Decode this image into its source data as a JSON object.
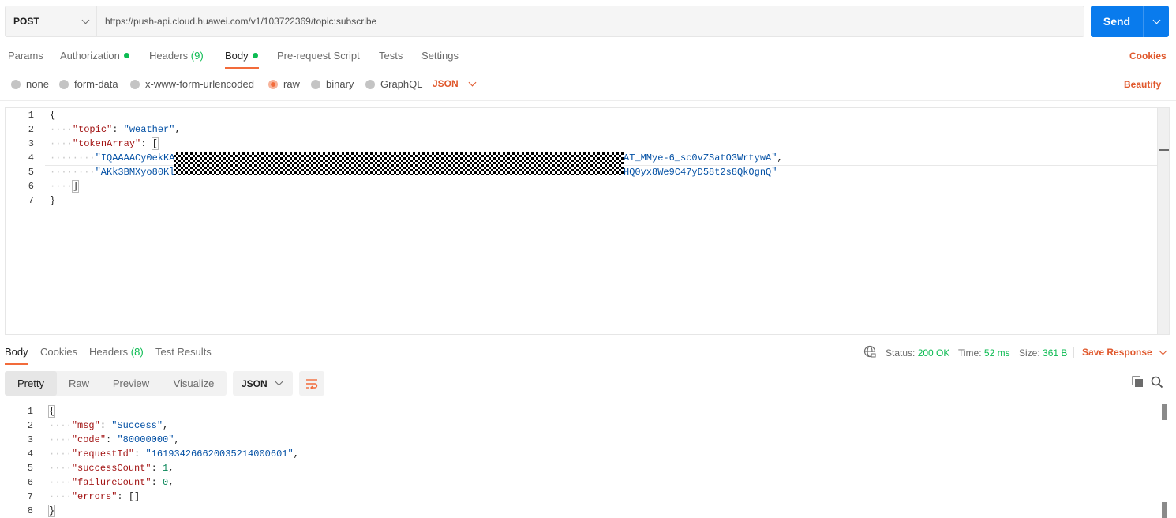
{
  "request": {
    "method": "POST",
    "url": "https://push-api.cloud.huawei.com/v1/103722369/topic:subscribe",
    "send_label": "Send"
  },
  "request_tabs": {
    "params": "Params",
    "authorization": "Authorization",
    "headers": "Headers",
    "headers_count": "(9)",
    "body": "Body",
    "pre_request": "Pre-request Script",
    "tests": "Tests",
    "settings": "Settings",
    "cookies": "Cookies"
  },
  "body_types": {
    "none": "none",
    "form_data": "form-data",
    "urlencoded": "x-www-form-urlencoded",
    "raw": "raw",
    "binary": "binary",
    "graphql": "GraphQL",
    "language": "JSON",
    "beautify": "Beautify"
  },
  "request_body": {
    "line_numbers": [
      "1",
      "2",
      "3",
      "4",
      "5",
      "6",
      "7"
    ],
    "l1": "{",
    "l2_key": "\"topic\"",
    "l2_sep": ": ",
    "l2_val": "\"weather\"",
    "l2_end": ",",
    "l3_key": "\"tokenArray\"",
    "l3_sep": ": ",
    "l3_open": "[",
    "l4_start": "\"IQAAAACy0ekKA",
    "l4_end": "AT_MMye-6_sc0vZSatO3WrtywA\"",
    "l4_comma": ",",
    "l5_start": "\"AKk3BMXyo80Kl",
    "l5_end": "HQ0yx8We9C47yD58t2s8QkOgnQ\"",
    "l6": "]",
    "l7": "}"
  },
  "response_tabs": {
    "body": "Body",
    "cookies": "Cookies",
    "headers": "Headers",
    "headers_count": "(8)",
    "test_results": "Test Results"
  },
  "response_status": {
    "status_label": "Status:",
    "status_value": "200 OK",
    "time_label": "Time:",
    "time_value": "52 ms",
    "size_label": "Size:",
    "size_value": "361 B",
    "save_response": "Save Response"
  },
  "view_modes": {
    "pretty": "Pretty",
    "raw": "Raw",
    "preview": "Preview",
    "visualize": "Visualize",
    "format": "JSON"
  },
  "response_body": {
    "line_numbers": [
      "1",
      "2",
      "3",
      "4",
      "5",
      "6",
      "7",
      "8"
    ],
    "l1": "{",
    "l2_key": "\"msg\"",
    "l2_val": "\"Success\"",
    "l3_key": "\"code\"",
    "l3_val": "\"80000000\"",
    "l4_key": "\"requestId\"",
    "l4_val": "\"161934266620035214000601\"",
    "l5_key": "\"successCount\"",
    "l5_val": "1",
    "l6_key": "\"failureCount\"",
    "l6_val": "0",
    "l7_key": "\"errors\"",
    "l7_val": "[]",
    "l8": "}",
    "sep": ": ",
    "comma": ","
  },
  "colors": {
    "accent": "#f26b3a",
    "send": "#097bed",
    "success": "#0cbb52"
  }
}
